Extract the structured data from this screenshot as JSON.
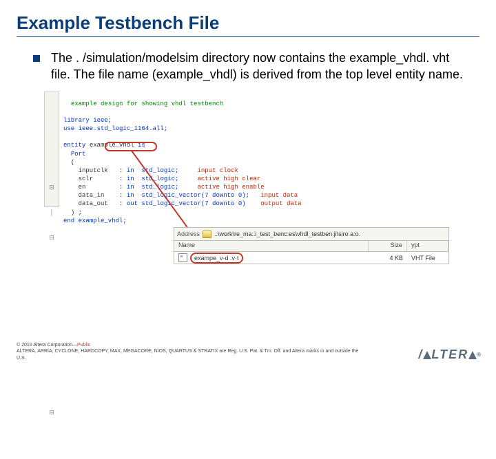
{
  "title": "Example Testbench File",
  "body": "The . /simulation/modelsim directory now contains the example_vhdl. vht file.  The file name (example_vhdl) is derived from the top level entity name.",
  "code": {
    "comment": "example design for showing vhdl testbench",
    "lib1": "library ieee;",
    "lib2": "use ieee.std_logic_1164.all;",
    "entity_kw": "entity",
    "entity_name": "example_vhdl",
    "entity_is": "is",
    "port_kw": "Port",
    "p1_name": "inputclk",
    "p1_dir": ": in  std_logic;",
    "p1_cmt": "input clock",
    "p2_name": "sclr",
    "p2_dir": ": in  std_logic;",
    "p2_cmt": "active high clear",
    "p3_name": "en",
    "p3_dir": ": in  std_logic;",
    "p3_cmt": "active high enable",
    "p4_name": "data_in",
    "p4_dir": ": in  std_logic_vector(7 downto 0);",
    "p4_cmt": "input data",
    "p5_name": "data_out",
    "p5_dir": ": out std_logic_vector(7 downto 0)",
    "p5_cmt": "output data",
    "end_port": ") ;",
    "end_entity": "end example_vhdl;"
  },
  "gutter": [
    "",
    "",
    "",
    "⊟",
    "│",
    "⊟",
    "",
    "",
    "",
    "",
    "",
    "",
    "⊟",
    ""
  ],
  "filebrowser": {
    "address_label": "Address",
    "path": "..\\work\\re_ma.:i_test_benc:es\\vhdl_testben:ji\\siro a:o.",
    "col_name": "Name",
    "col_size": "Size",
    "col_type": "ypt",
    "file_name": "exampe_v·d .v·t",
    "file_size": "4 KB",
    "file_type": "VHT File"
  },
  "footer": {
    "copyright": "© 2010 Altera Corporation—",
    "public": "Public",
    "legal": "ALTERA, ARRIA, CYCLONE, HARDCOPY, MAX, MEGACORE, NIOS, QUARTUS & STRATIX are Reg. U.S. Pat. & Tm. Off. and Altera marks in and outside the U.S."
  },
  "logo_text_left": "/",
  "logo_text_right": "LTER",
  "logo_reg": "®"
}
